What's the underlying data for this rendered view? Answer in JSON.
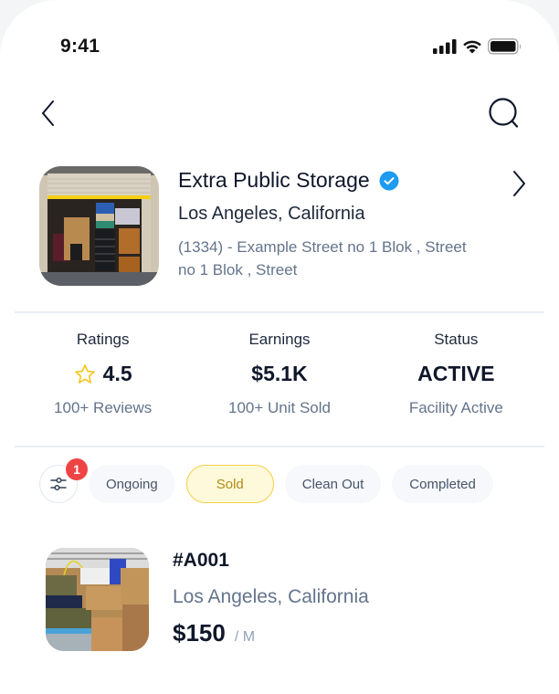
{
  "status_bar": {
    "time": "9:41",
    "icons": [
      "signal-icon",
      "wifi-icon",
      "battery-icon"
    ]
  },
  "nav": {
    "back_icon": "chevron-left-icon",
    "search_icon": "search-icon"
  },
  "facility": {
    "name": "Extra Public Storage",
    "verified": true,
    "city": "Los Angeles, California",
    "address": "(1334) - Example Street no 1 Blok , Street no 1 Blok , Street",
    "accent_verified": "#1d9bf0"
  },
  "stats": [
    {
      "label": "Ratings",
      "value": "4.5",
      "icon": "star-icon",
      "sub": "100+ Reviews"
    },
    {
      "label": "Earnings",
      "value": "$5.1K",
      "sub": "100+ Unit Sold"
    },
    {
      "label": "Status",
      "value": "ACTIVE",
      "sub": "Facility Active"
    }
  ],
  "filters": {
    "badge_count": "1",
    "chips": [
      {
        "label": "Ongoing",
        "active": false
      },
      {
        "label": "Sold",
        "active": true
      },
      {
        "label": "Clean Out",
        "active": false
      },
      {
        "label": "Completed",
        "active": false
      }
    ],
    "active_color": "#f2cf48",
    "badge_color": "#ef4444"
  },
  "units": [
    {
      "id": "#A001",
      "city": "Los Angeles, California",
      "price": "$150",
      "price_suffix": "/ M"
    }
  ]
}
